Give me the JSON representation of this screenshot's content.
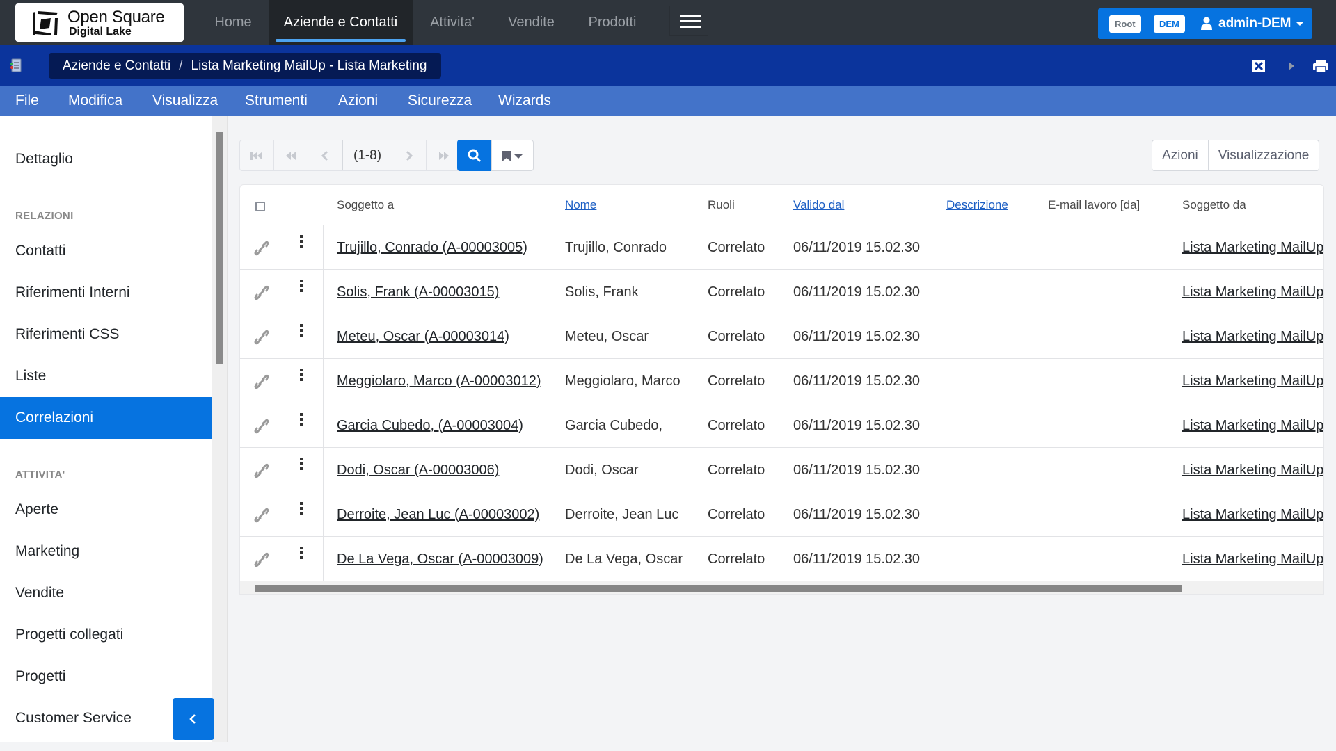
{
  "app": {
    "logo_title": "Open Square",
    "logo_subtitle": "Digital Lake"
  },
  "topnav": {
    "tabs": [
      {
        "label": "Home",
        "active": false
      },
      {
        "label": "Aziende e Contatti",
        "active": true
      },
      {
        "label": "Attivita'",
        "active": false
      },
      {
        "label": "Vendite",
        "active": false
      },
      {
        "label": "Prodotti",
        "active": false
      }
    ],
    "menu_icon": "hamburger-icon",
    "user": {
      "badge_root": "Root",
      "badge_company": "DEM",
      "username": "admin-DEM"
    }
  },
  "breadcrumb": {
    "items": [
      "Aziende e Contatti",
      "Lista Marketing MailUp - Lista Marketing"
    ],
    "separator": "/"
  },
  "menubar": {
    "items": [
      "File",
      "Modifica",
      "Visualizza",
      "Strumenti",
      "Azioni",
      "Sicurezza",
      "Wizards"
    ]
  },
  "sidebar": {
    "top_item": "Dettaglio",
    "sections": [
      {
        "title": "RELAZIONI",
        "items": [
          "Contatti",
          "Riferimenti Interni",
          "Riferimenti CSS",
          "Liste",
          "Correlazioni"
        ]
      },
      {
        "title": "ATTIVITA'",
        "items": [
          "Aperte",
          "Marketing",
          "Vendite",
          "Progetti collegati",
          "Progetti",
          "Customer Service"
        ]
      }
    ],
    "active_item": "Correlazioni"
  },
  "toolbar": {
    "page_range": "(1-8)",
    "actions_label": "Azioni",
    "view_label": "Visualizzazione"
  },
  "table": {
    "columns": [
      "Soggetto a",
      "Nome",
      "Ruoli",
      "Valido dal",
      "Descrizione",
      "E-mail lavoro [da]",
      "Soggetto da"
    ],
    "rows": [
      {
        "soggetto_a": "Trujillo, Conrado (A-00003005)",
        "nome": "Trujillo, Conrado",
        "ruoli": "Correlato",
        "valido_dal": "06/11/2019 15.02.30",
        "descrizione": "",
        "email": "",
        "soggetto_da": "Lista Marketing MailUp"
      },
      {
        "soggetto_a": "Solis, Frank (A-00003015)",
        "nome": "Solis, Frank",
        "ruoli": "Correlato",
        "valido_dal": "06/11/2019 15.02.30",
        "descrizione": "",
        "email": "",
        "soggetto_da": "Lista Marketing MailUp"
      },
      {
        "soggetto_a": "Meteu, Oscar (A-00003014)",
        "nome": "Meteu, Oscar",
        "ruoli": "Correlato",
        "valido_dal": "06/11/2019 15.02.30",
        "descrizione": "",
        "email": "",
        "soggetto_da": "Lista Marketing MailUp"
      },
      {
        "soggetto_a": "Meggiolaro, Marco (A-00003012)",
        "nome": "Meggiolaro, Marco",
        "ruoli": "Correlato",
        "valido_dal": "06/11/2019 15.02.30",
        "descrizione": "",
        "email": "",
        "soggetto_da": "Lista Marketing MailUp"
      },
      {
        "soggetto_a": "Garcia Cubedo, (A-00003004)",
        "nome": "Garcia Cubedo,",
        "ruoli": "Correlato",
        "valido_dal": "06/11/2019 15.02.30",
        "descrizione": "",
        "email": "",
        "soggetto_da": "Lista Marketing MailUp"
      },
      {
        "soggetto_a": "Dodi, Oscar (A-00003006)",
        "nome": "Dodi, Oscar",
        "ruoli": "Correlato",
        "valido_dal": "06/11/2019 15.02.30",
        "descrizione": "",
        "email": "",
        "soggetto_da": "Lista Marketing MailUp"
      },
      {
        "soggetto_a": "Derroite, Jean Luc (A-00003002)",
        "nome": "Derroite, Jean Luc",
        "ruoli": "Correlato",
        "valido_dal": "06/11/2019 15.02.30",
        "descrizione": "",
        "email": "",
        "soggetto_da": "Lista Marketing MailUp"
      },
      {
        "soggetto_a": "De La Vega, Oscar (A-00003009)",
        "nome": "De La Vega, Oscar",
        "ruoli": "Correlato",
        "valido_dal": "06/11/2019 15.02.30",
        "descrizione": "",
        "email": "",
        "soggetto_da": "Lista Marketing MailUp"
      }
    ]
  },
  "colors": {
    "topnav_bg": "#2f353c",
    "breadcrumb_bg": "#0b349c",
    "menubar_bg": "#4373c9",
    "accent": "#0673e0"
  }
}
